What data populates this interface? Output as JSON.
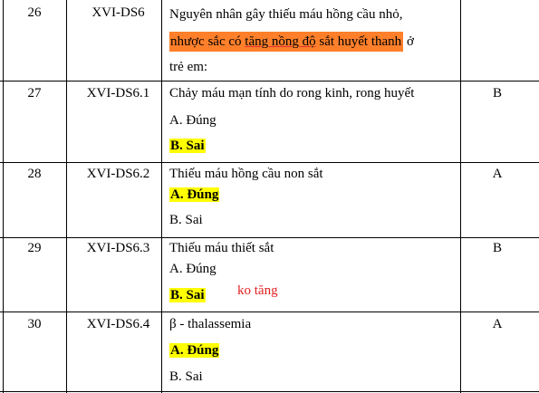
{
  "rows": [
    {
      "number": "26",
      "code": "XVI-DS6",
      "question_line1": "Nguyên nhân gây thiếu máu hồng cầu nhỏ,",
      "question_line2_pre": "nhược sắc có ",
      "question_line2_underlined": "tăng nồng độ",
      "question_line2_post": " sắt huyết thanh",
      "question_line2_tail": " ở",
      "question_line3": "trẻ em:",
      "answer": ""
    },
    {
      "number": "27",
      "code": "XVI-DS6.1",
      "statement": "Chảy máu mạn tính do rong kinh, rong huyết",
      "option_a": "A. Đúng",
      "option_b": "B. Sai",
      "answer": "B"
    },
    {
      "number": "28",
      "code": "XVI-DS6.2",
      "statement": "Thiếu máu hồng cầu non sắt",
      "option_a": "A. Đúng",
      "option_b": "B. Sai",
      "answer": "A"
    },
    {
      "number": "29",
      "code": "XVI-DS6.3",
      "statement": "Thiếu máu thiết sắt",
      "option_a": "A. Đúng",
      "option_b": "B. Sai",
      "note": "ko tăng",
      "answer": "B"
    },
    {
      "number": "30",
      "code": "XVI-DS6.4",
      "statement": "β - thalassemia",
      "option_a": "A. Đúng",
      "option_b": "B. Sai",
      "answer": "A"
    }
  ],
  "colors": {
    "highlight_yellow": "#ffff00",
    "highlight_orange": "#ff7f2a",
    "note_red": "#e02020"
  }
}
